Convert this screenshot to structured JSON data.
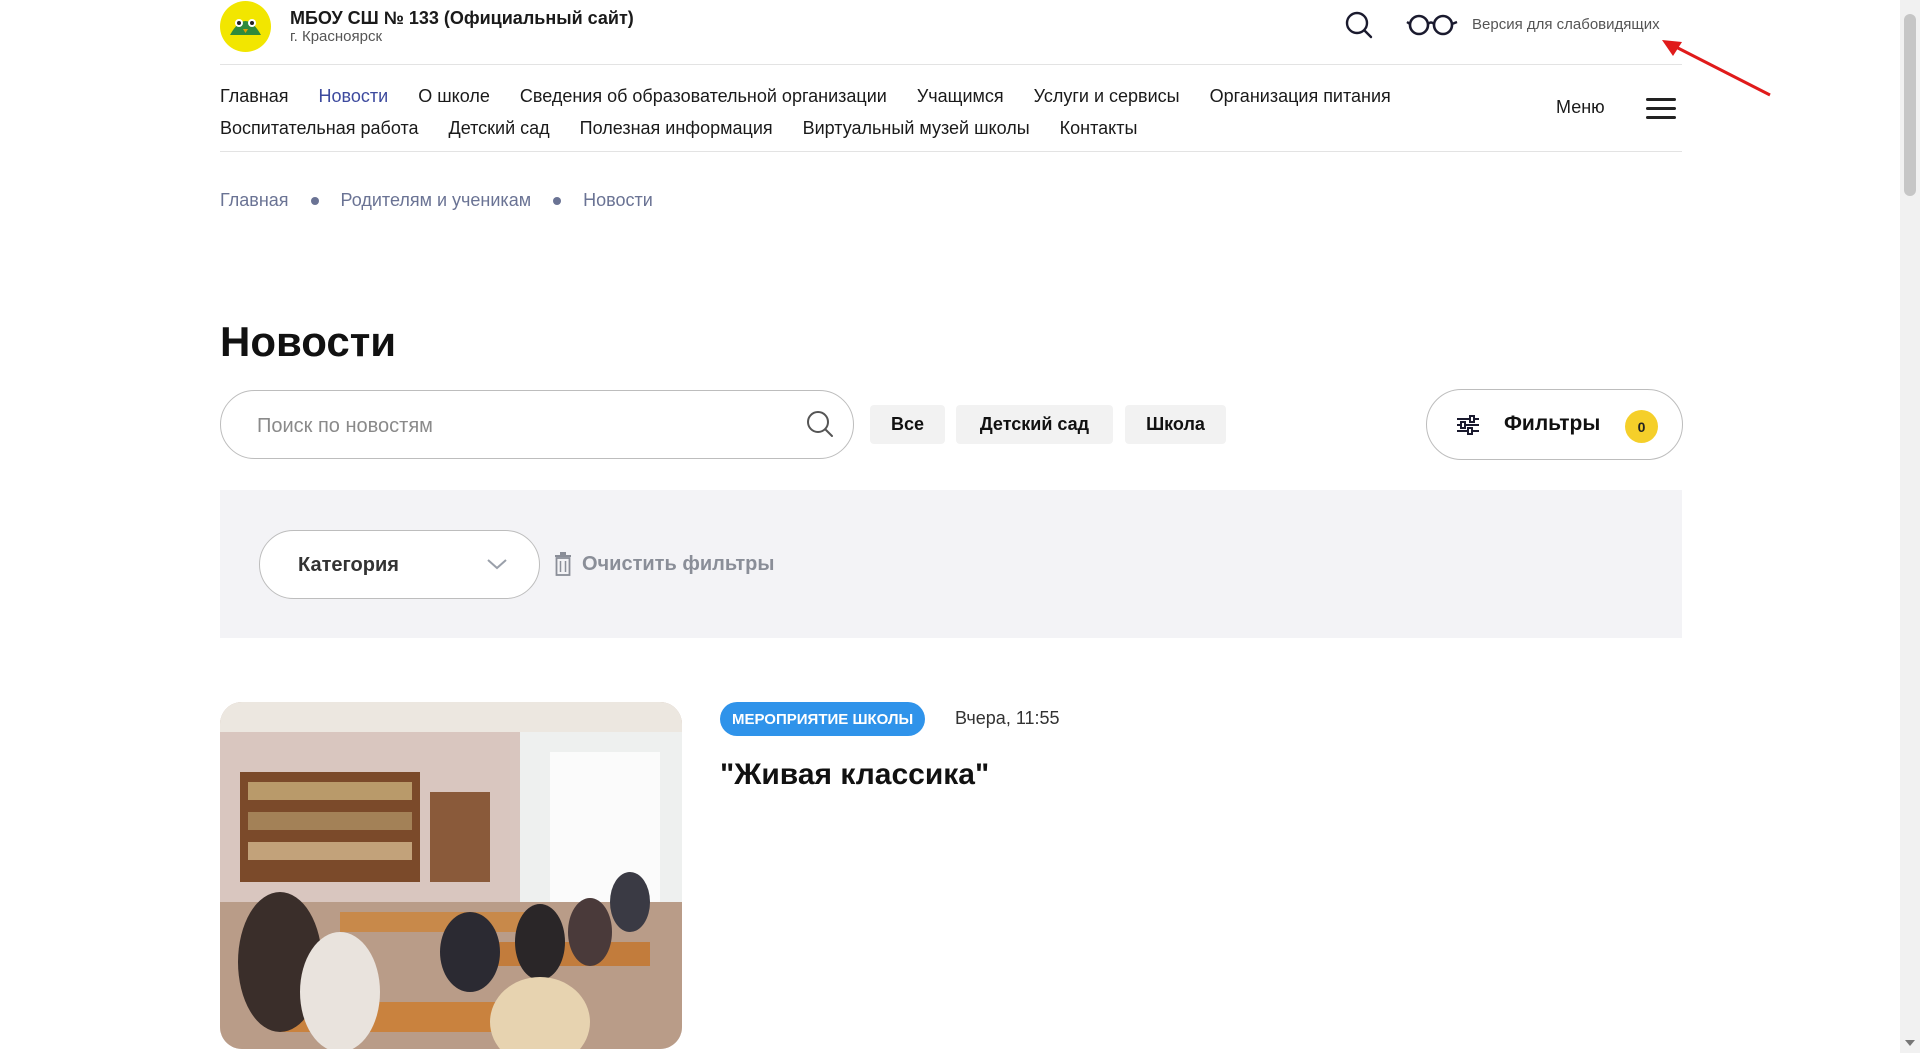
{
  "header": {
    "site_title": "МБОУ СШ № 133 (Официальный сайт)",
    "city": "г. Красноярск",
    "vision_link": "Версия для слабовидящих"
  },
  "nav": {
    "row1": [
      {
        "label": "Главная",
        "active": false
      },
      {
        "label": "Новости",
        "active": true
      },
      {
        "label": "О школе",
        "active": false
      },
      {
        "label": "Сведения об образовательной организации",
        "active": false
      },
      {
        "label": "Учащимся",
        "active": false
      },
      {
        "label": "Услуги и сервисы",
        "active": false
      },
      {
        "label": "Организация питания",
        "active": false
      }
    ],
    "row2": [
      {
        "label": "Воспитательная работа"
      },
      {
        "label": "Детский сад"
      },
      {
        "label": "Полезная информация"
      },
      {
        "label": "Виртуальный музей школы"
      },
      {
        "label": "Контакты"
      }
    ],
    "menu_label": "Меню"
  },
  "breadcrumb": [
    "Главная",
    "Родителям и ученикам",
    "Новости"
  ],
  "page_title": "Новости",
  "search": {
    "placeholder": "Поиск по новостям",
    "value": ""
  },
  "chips": {
    "all": "Все",
    "kindergarten": "Детский сад",
    "school": "Школа"
  },
  "filters": {
    "label": "Фильтры",
    "count": "0"
  },
  "filter_panel": {
    "category_label": "Категория",
    "clear_label": "Очистить фильтры"
  },
  "news": [
    {
      "tag": "МЕРОПРИЯТИЕ ШКОЛЫ",
      "date": "Вчера, 11:55",
      "title": "\"Живая классика\""
    }
  ],
  "colors": {
    "accent": "#3d4a9e",
    "tag": "#2f93ea",
    "badge": "#f5cf2a",
    "panel": "#f3f3f6"
  }
}
